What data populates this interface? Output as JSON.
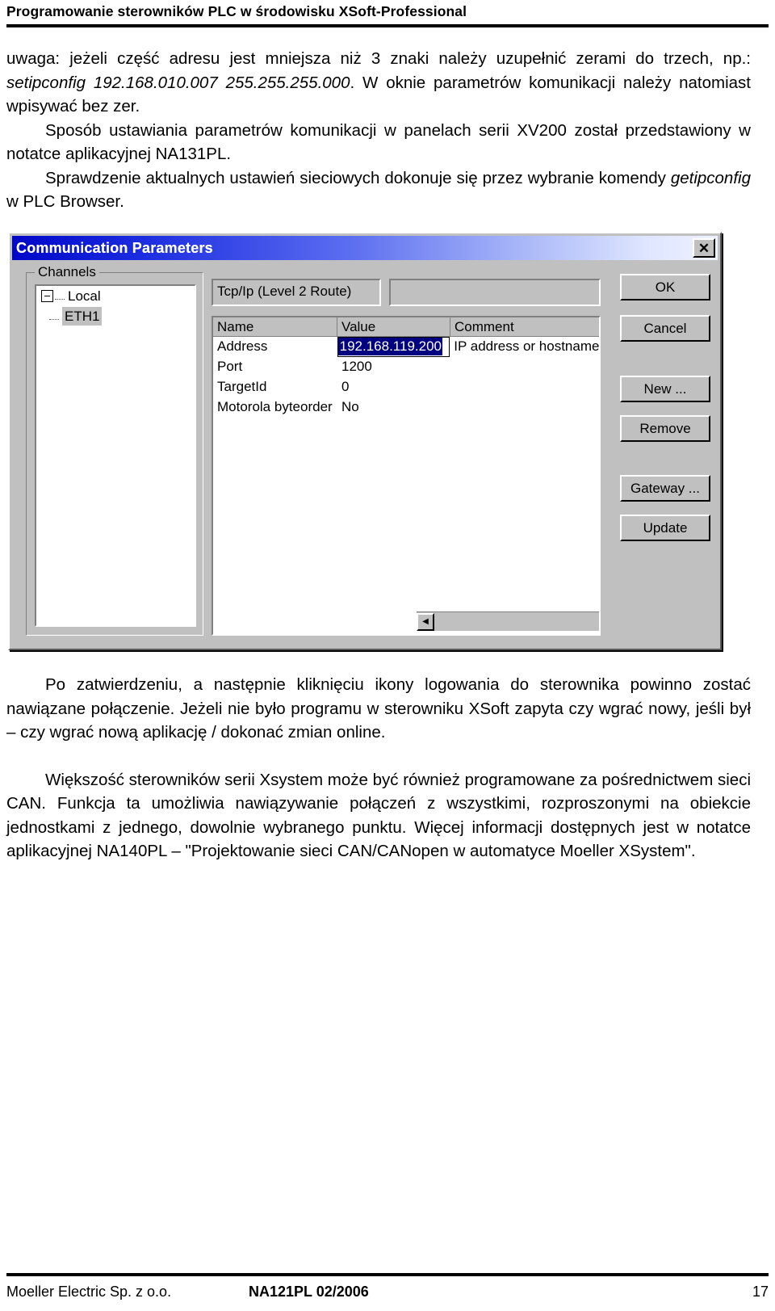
{
  "page_header": {
    "title": "Programowanie sterowników PLC w środowisku XSoft-Professional"
  },
  "body": {
    "paragraph_1_part1": "uwaga: jeżeli część adresu jest mniejsza niż 3 znaki należy uzupełnić zerami do trzech, np.: ",
    "paragraph_1_italic": "setipconfig 192.168.010.007 255.255.255.000",
    "paragraph_1_part2": ". W oknie parametrów komunikacji należy natomiast wpisywać bez zer.",
    "paragraph_2": "Sposób ustawiania parametrów komunikacji w panelach serii XV200 został przedstawiony w notatce aplikacyjnej NA131PL.",
    "paragraph_3_part1": "Sprawdzenie aktualnych ustawień sieciowych dokonuje się przez wybranie komendy ",
    "paragraph_3_italic": "getipconfig",
    "paragraph_3_part2": " w PLC Browser.",
    "paragraph_4": "Po zatwierdzeniu, a następnie kliknięciu ikony logowania do sterownika powinno zostać nawiązane połączenie. Jeżeli nie było programu w sterowniku XSoft zapyta czy wgrać nowy, jeśli był – czy wgrać nową aplikację / dokonać zmian online.",
    "paragraph_5": "Większość sterowników serii Xsystem może być również programowane za pośrednictwem sieci CAN. Funkcja ta umożliwia nawiązywanie połączeń z wszystkimi, rozproszonymi na obiekcie jednostkami z jednego, dowolnie wybranego punktu. Więcej informacji dostępnych jest w notatce aplikacyjnej NA140PL – \"Projektowanie sieci CAN/CANopen w automatyce Moeller XSystem\"."
  },
  "dialog": {
    "title": "Communication Parameters",
    "close_label": "✕",
    "channels_group_label": "Channels",
    "tree": {
      "root_label": "Local",
      "child_label": "ETH1"
    },
    "driver_field": "Tcp/Ip (Level 2 Route)",
    "name_field": "",
    "grid": {
      "headers": [
        "Name",
        "Value",
        "Comment"
      ],
      "rows": [
        {
          "name": "Address",
          "value": "192.168.119.200",
          "comment": "IP address or hostname",
          "editing": true
        },
        {
          "name": "Port",
          "value": "1200",
          "comment": "",
          "editing": false
        },
        {
          "name": "TargetId",
          "value": "0",
          "comment": "",
          "editing": false
        },
        {
          "name": "Motorola byteorder",
          "value": "No",
          "comment": "",
          "editing": false
        }
      ]
    },
    "scrollbar": {
      "left_arrow": "◀",
      "right_arrow": "▶"
    },
    "buttons": [
      {
        "label": "OK"
      },
      {
        "label": "Cancel"
      },
      {
        "label": "New ..."
      },
      {
        "label": "Remove"
      },
      {
        "label": "Gateway ..."
      },
      {
        "label": "Update"
      }
    ],
    "colors": {
      "titlebar_start": "#0006c8",
      "titlebar_end": "#eef1ff",
      "face": "#c0c0c0",
      "selection": "#000080"
    }
  },
  "footer": {
    "left": "Moeller Electric Sp. z o.o.",
    "center": "NA121PL 02/2006",
    "right": "17"
  }
}
